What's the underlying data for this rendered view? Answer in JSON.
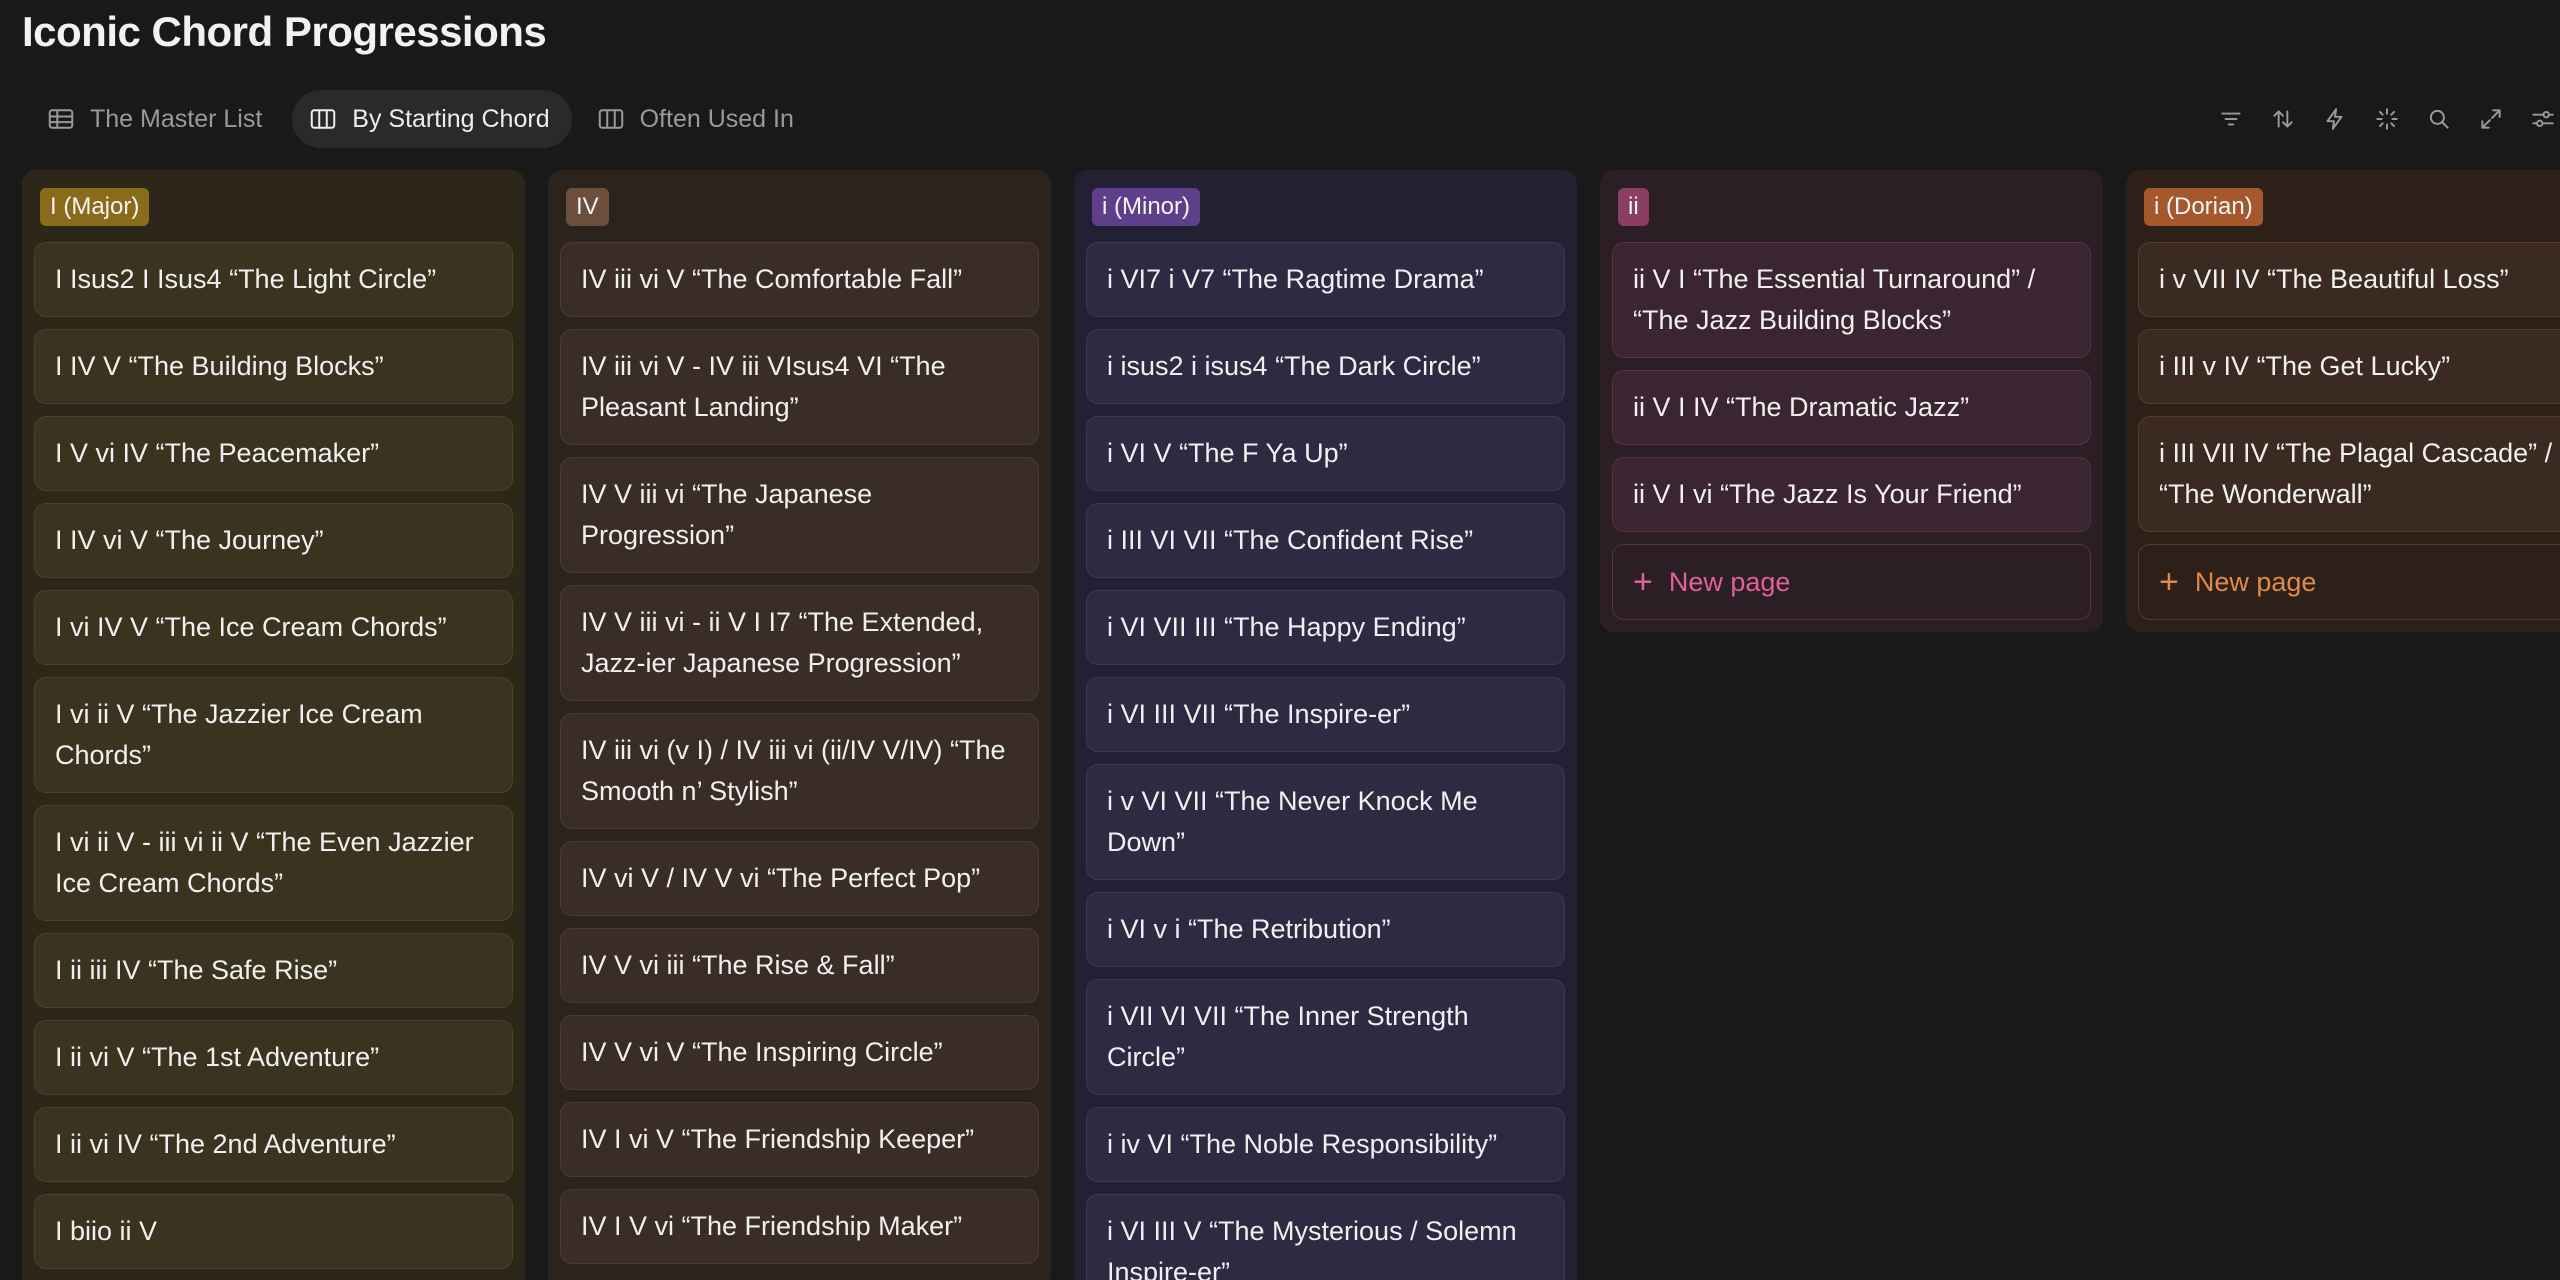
{
  "page": {
    "title": "Iconic Chord Progressions"
  },
  "tabs": [
    {
      "label": "The Master List",
      "icon": "table-icon",
      "active": false
    },
    {
      "label": "By Starting Chord",
      "icon": "board-icon",
      "active": true
    },
    {
      "label": "Often Used In",
      "icon": "board-icon",
      "active": false
    }
  ],
  "toolbar": {
    "icons": [
      "filter-icon",
      "sort-icon",
      "automation-bolt-icon",
      "ai-sparkle-icon",
      "search-icon",
      "expand-icon",
      "settings-sliders-icon"
    ]
  },
  "columns": [
    {
      "label": "I (Major)",
      "color": "#8a6b1c",
      "cards": [
        "I Isus2 I Isus4 “The Light Circle”",
        "I IV V “The Building Blocks”",
        "I V vi IV “The Peacemaker”",
        "I IV vi V “The Journey”",
        "I vi IV V “The Ice Cream Chords”",
        "I vi ii V “The Jazzier Ice Cream Chords”",
        "I vi ii V - iii vi ii V “The Even Jazzier Ice Cream Chords”",
        "I ii iii IV “The Safe Rise”",
        "I ii vi V “The 1st Adventure”",
        "I ii vi IV “The 2nd Adventure”",
        "I biio ii V"
      ]
    },
    {
      "label": "IV",
      "color": "#6b4e3c",
      "cards": [
        "IV iii vi V “The Comfortable Fall”",
        "IV iii vi V - IV iii VIsus4 VI “The Pleasant Landing”",
        "IV V iii vi “The Japanese Progression”",
        "IV V iii vi - ii V I I7 “The Extended, Jazz-ier Japanese Progression”",
        "IV iii vi (v I) / IV iii vi (ii/IV V/IV) “The Smooth n’ Stylish”",
        "IV vi V / IV V vi “The Perfect Pop”",
        "IV V vi iii “The Rise & Fall”",
        "IV V vi V “The Inspiring Circle”",
        "IV I vi V “The Friendship Keeper”",
        "IV I V vi “The Friendship Maker”"
      ]
    },
    {
      "label": "i (Minor)",
      "color": "#5d3f8a",
      "cards": [
        "i VI7 i V7 “The Ragtime Drama”",
        "i isus2 i isus4 “The Dark Circle”",
        "i VI V “The F Ya Up”",
        "i III VI VII “The Confident Rise”",
        "i VI VII III “The Happy Ending”",
        "i VI III VII “The Inspire-er”",
        "i v VI VII “The Never Knock Me Down”",
        "i VI v i “The Retribution”",
        "i VII VI VII “The Inner Strength Circle”",
        "i iv VI “The Noble Responsibility”",
        "i VI III V “The Mysterious / Solemn Inspire-er”"
      ]
    },
    {
      "label": "ii",
      "color": "#8a3f62",
      "cards": [
        "ii V I “The Essential Turnaround” / “The Jazz Building Blocks”",
        "ii V I IV “The Dramatic Jazz”",
        "ii V I vi “The Jazz Is Your Friend”"
      ],
      "new_page": "New page"
    },
    {
      "label": "i (Dorian)",
      "color": "#a4582c",
      "cards": [
        "i v VII IV “The Beautiful Loss”",
        "i III v IV “The Get Lucky”",
        "i III VII IV “The Plagal Cascade” / “The Wonderwall”"
      ],
      "new_page": "New page"
    }
  ]
}
